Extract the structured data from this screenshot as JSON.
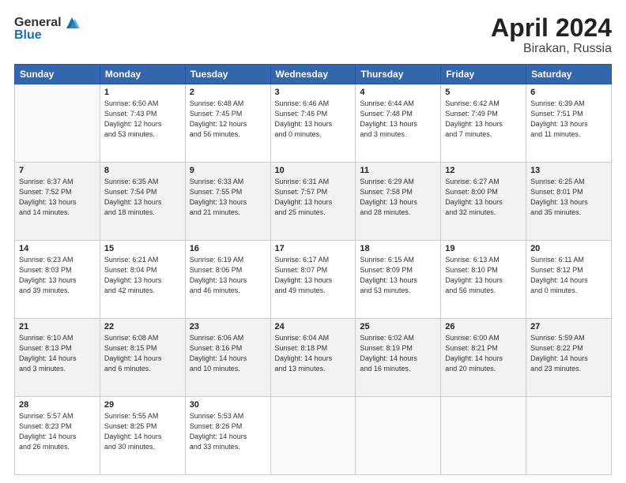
{
  "header": {
    "logo_general": "General",
    "logo_blue": "Blue",
    "month": "April 2024",
    "location": "Birakan, Russia"
  },
  "weekdays": [
    "Sunday",
    "Monday",
    "Tuesday",
    "Wednesday",
    "Thursday",
    "Friday",
    "Saturday"
  ],
  "weeks": [
    [
      {
        "day": "",
        "info": ""
      },
      {
        "day": "1",
        "info": "Sunrise: 6:50 AM\nSunset: 7:43 PM\nDaylight: 12 hours\nand 53 minutes."
      },
      {
        "day": "2",
        "info": "Sunrise: 6:48 AM\nSunset: 7:45 PM\nDaylight: 12 hours\nand 56 minutes."
      },
      {
        "day": "3",
        "info": "Sunrise: 6:46 AM\nSunset: 7:46 PM\nDaylight: 13 hours\nand 0 minutes."
      },
      {
        "day": "4",
        "info": "Sunrise: 6:44 AM\nSunset: 7:48 PM\nDaylight: 13 hours\nand 3 minutes."
      },
      {
        "day": "5",
        "info": "Sunrise: 6:42 AM\nSunset: 7:49 PM\nDaylight: 13 hours\nand 7 minutes."
      },
      {
        "day": "6",
        "info": "Sunrise: 6:39 AM\nSunset: 7:51 PM\nDaylight: 13 hours\nand 11 minutes."
      }
    ],
    [
      {
        "day": "7",
        "info": "Sunrise: 6:37 AM\nSunset: 7:52 PM\nDaylight: 13 hours\nand 14 minutes."
      },
      {
        "day": "8",
        "info": "Sunrise: 6:35 AM\nSunset: 7:54 PM\nDaylight: 13 hours\nand 18 minutes."
      },
      {
        "day": "9",
        "info": "Sunrise: 6:33 AM\nSunset: 7:55 PM\nDaylight: 13 hours\nand 21 minutes."
      },
      {
        "day": "10",
        "info": "Sunrise: 6:31 AM\nSunset: 7:57 PM\nDaylight: 13 hours\nand 25 minutes."
      },
      {
        "day": "11",
        "info": "Sunrise: 6:29 AM\nSunset: 7:58 PM\nDaylight: 13 hours\nand 28 minutes."
      },
      {
        "day": "12",
        "info": "Sunrise: 6:27 AM\nSunset: 8:00 PM\nDaylight: 13 hours\nand 32 minutes."
      },
      {
        "day": "13",
        "info": "Sunrise: 6:25 AM\nSunset: 8:01 PM\nDaylight: 13 hours\nand 35 minutes."
      }
    ],
    [
      {
        "day": "14",
        "info": "Sunrise: 6:23 AM\nSunset: 8:03 PM\nDaylight: 13 hours\nand 39 minutes."
      },
      {
        "day": "15",
        "info": "Sunrise: 6:21 AM\nSunset: 8:04 PM\nDaylight: 13 hours\nand 42 minutes."
      },
      {
        "day": "16",
        "info": "Sunrise: 6:19 AM\nSunset: 8:06 PM\nDaylight: 13 hours\nand 46 minutes."
      },
      {
        "day": "17",
        "info": "Sunrise: 6:17 AM\nSunset: 8:07 PM\nDaylight: 13 hours\nand 49 minutes."
      },
      {
        "day": "18",
        "info": "Sunrise: 6:15 AM\nSunset: 8:09 PM\nDaylight: 13 hours\nand 53 minutes."
      },
      {
        "day": "19",
        "info": "Sunrise: 6:13 AM\nSunset: 8:10 PM\nDaylight: 13 hours\nand 56 minutes."
      },
      {
        "day": "20",
        "info": "Sunrise: 6:11 AM\nSunset: 8:12 PM\nDaylight: 14 hours\nand 0 minutes."
      }
    ],
    [
      {
        "day": "21",
        "info": "Sunrise: 6:10 AM\nSunset: 8:13 PM\nDaylight: 14 hours\nand 3 minutes."
      },
      {
        "day": "22",
        "info": "Sunrise: 6:08 AM\nSunset: 8:15 PM\nDaylight: 14 hours\nand 6 minutes."
      },
      {
        "day": "23",
        "info": "Sunrise: 6:06 AM\nSunset: 8:16 PM\nDaylight: 14 hours\nand 10 minutes."
      },
      {
        "day": "24",
        "info": "Sunrise: 6:04 AM\nSunset: 8:18 PM\nDaylight: 14 hours\nand 13 minutes."
      },
      {
        "day": "25",
        "info": "Sunrise: 6:02 AM\nSunset: 8:19 PM\nDaylight: 14 hours\nand 16 minutes."
      },
      {
        "day": "26",
        "info": "Sunrise: 6:00 AM\nSunset: 8:21 PM\nDaylight: 14 hours\nand 20 minutes."
      },
      {
        "day": "27",
        "info": "Sunrise: 5:59 AM\nSunset: 8:22 PM\nDaylight: 14 hours\nand 23 minutes."
      }
    ],
    [
      {
        "day": "28",
        "info": "Sunrise: 5:57 AM\nSunset: 8:23 PM\nDaylight: 14 hours\nand 26 minutes."
      },
      {
        "day": "29",
        "info": "Sunrise: 5:55 AM\nSunset: 8:25 PM\nDaylight: 14 hours\nand 30 minutes."
      },
      {
        "day": "30",
        "info": "Sunrise: 5:53 AM\nSunset: 8:26 PM\nDaylight: 14 hours\nand 33 minutes."
      },
      {
        "day": "",
        "info": ""
      },
      {
        "day": "",
        "info": ""
      },
      {
        "day": "",
        "info": ""
      },
      {
        "day": "",
        "info": ""
      }
    ]
  ]
}
